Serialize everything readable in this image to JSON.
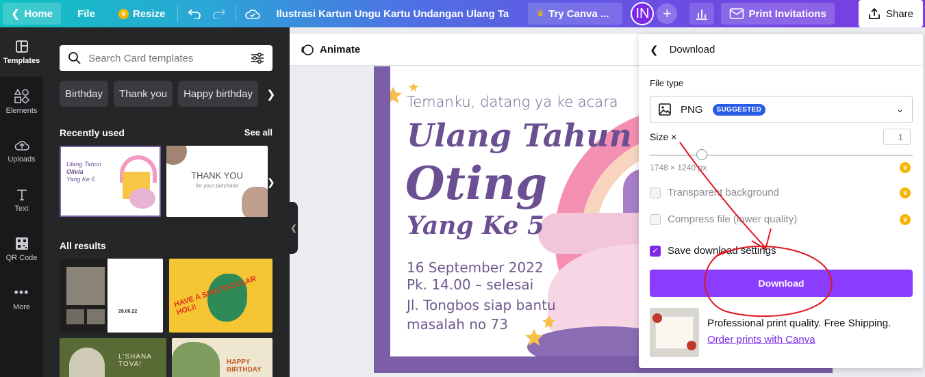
{
  "topbar": {
    "home_label": "Home",
    "file_label": "File",
    "resize_label": "Resize",
    "doc_title": "Ilustrasi Kartun Ungu Kartu Undangan Ulang Ta...",
    "try_label": "Try Canva ...",
    "avatar_initials": "IN",
    "print_label": "Print Invitations",
    "share_label": "Share"
  },
  "rail": {
    "items": [
      {
        "label": "Templates",
        "icon": "templates-icon"
      },
      {
        "label": "Elements",
        "icon": "elements-icon"
      },
      {
        "label": "Uploads",
        "icon": "upload-icon"
      },
      {
        "label": "Text",
        "icon": "text-icon"
      },
      {
        "label": "QR Code",
        "icon": "qr-code-icon"
      },
      {
        "label": "More",
        "icon": "more-icon"
      }
    ]
  },
  "panel": {
    "search_placeholder": "Search Card templates",
    "chips": [
      "Birthday",
      "Thank you",
      "Happy birthday"
    ],
    "recently_used": "Recently used",
    "see_all": "See all",
    "all_results": "All results"
  },
  "thumbs": {
    "recent2_title": "THANK YOU",
    "recent2_sub": "for your purchase",
    "res2_text": "HAVE A SPECTACULAR HOLI!",
    "res3_text": "L'SHANA TOVA!",
    "res4_text": "HAPPY BIRTHDAY",
    "res1_date": "28.06.22"
  },
  "canvas": {
    "animate_label": "Animate",
    "invite_line": "Temanku, datang ya ke acara",
    "title_1": "Ulang Tahun",
    "title_2": "Oting",
    "title_3": "Yang Ke 5",
    "date": "16 September 2022",
    "time": "Pk. 14.00 – selesai",
    "address_1": "Jl. Tongbos siap bantu",
    "address_2": "masalah no 73"
  },
  "download": {
    "header": "Download",
    "file_type_label": "File type",
    "file_type_value": "PNG",
    "suggested_badge": "SUGGESTED",
    "size_label": "Size ×",
    "size_value": "1",
    "dimensions": "1748 × 1240 px",
    "transparent_label": "Transparent background",
    "compress_label": "Compress file (lower quality)",
    "save_settings_label": "Save download settings",
    "download_button": "Download",
    "promo_text": "Professional print quality. Free Shipping.",
    "promo_link": "Order prints with Canva"
  },
  "colors": {
    "brand_purple": "#8b3dff",
    "card_purple": "#7b5ea7",
    "annotation_red": "#e0161e",
    "panel_dark": "#252627"
  }
}
